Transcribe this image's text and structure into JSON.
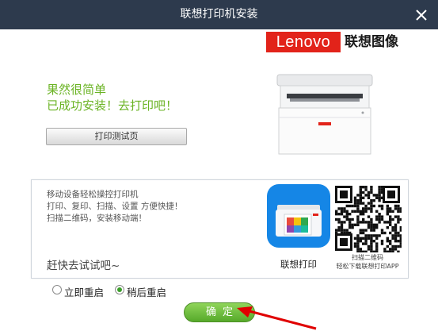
{
  "window": {
    "title": "联想打印机安装"
  },
  "brand": {
    "logo_text": "Lenovo",
    "name_cn": "联想图像",
    "color": "#e2231a"
  },
  "main": {
    "headline_1": "果然很简单",
    "headline_2": "已成功安装！去打印吧！",
    "headline_color": "#6ab323",
    "test_print_button": "打印测试页"
  },
  "promo": {
    "lines": [
      "移动设备轻松操控打印机",
      "打印、复印、扫描、设置 方便快捷！",
      "扫描二维码，安装移动端！"
    ],
    "try_text": "赶快去试试吧~",
    "app_name": "联想打印",
    "qr_caption_1": "扫描二维码",
    "qr_caption_2": "轻松下载联想打印APP"
  },
  "restart": {
    "options": [
      {
        "label": "立即重启",
        "selected": false
      },
      {
        "label": "稍后重启",
        "selected": true
      }
    ]
  },
  "footer": {
    "ok_button": "确定",
    "ok_color": "#56a92a"
  },
  "icons": [
    "close-icon",
    "printer-image",
    "lenovo-print-app-icon",
    "qr-code",
    "red-arrow-annotation"
  ]
}
